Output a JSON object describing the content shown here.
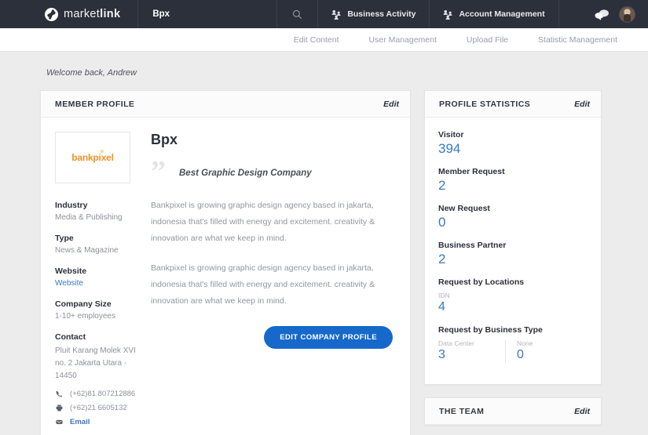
{
  "header": {
    "logo_text_light": "market",
    "logo_text_bold": "link",
    "logo_icon": "marketlink-circle-icon",
    "org": "Bpx",
    "search_icon": "search-icon",
    "items": [
      {
        "label": "Business Activity",
        "icon": "people-group-icon"
      },
      {
        "label": "Account Management",
        "icon": "people-group-icon"
      }
    ],
    "chat_icon": "chat-bubbles-icon",
    "avatar": "user-avatar"
  },
  "subnav": {
    "items": [
      "Edit Content",
      "User Management",
      "Upload File",
      "Statistic Management"
    ]
  },
  "welcome": "Welcome back, Andrew",
  "member_profile": {
    "title": "MEMBER PROFILE",
    "edit_label": "Edit",
    "logo_word": "bankpixel",
    "org_name": "Bpx",
    "tagline": "Best Graphic Design Company",
    "paragraph_1": "Bankpixel is growing graphic design agency based in jakarta, indonesia that's filled with energy and excitement. creativity & innovation are what we keep in mind.",
    "paragraph_2": "Bankpixel is growing graphic design agency based in jakarta, indonesia that's filled with energy and excitement. creativity & innovation are what we keep in mind.",
    "cta_label": "EDIT COMPANY PROFILE",
    "fields": [
      {
        "label": "Industry",
        "value": "Media & Publishing"
      },
      {
        "label": "Type",
        "value": "News & Magazine"
      },
      {
        "label": "Website",
        "value": "Website",
        "is_link": true
      },
      {
        "label": "Company Size",
        "value": "1-10+ employees"
      }
    ],
    "contact": {
      "label": "Contact",
      "address": "Pluit Karang Molek XVI no. 2 Jakarta Utara - 14450",
      "phone": "(+62)81 807212886",
      "fax": "(+62)21 6605132",
      "email": "Email"
    }
  },
  "profile_statistics": {
    "title": "PROFILE STATISTICS",
    "edit_label": "Edit",
    "stats": [
      {
        "label": "Visitor",
        "value": "394"
      },
      {
        "label": "Member Request",
        "value": "2"
      },
      {
        "label": "New Request",
        "value": "0"
      },
      {
        "label": "Business Partner",
        "value": "2"
      }
    ],
    "by_locations": {
      "label": "Request by Locations",
      "items": [
        {
          "label": "IDN",
          "value": "4"
        }
      ]
    },
    "by_business_type": {
      "label": "Request by Business Type",
      "items": [
        {
          "label": "Data Center",
          "value": "3"
        },
        {
          "label": "None",
          "value": "0"
        }
      ]
    }
  },
  "the_team": {
    "title": "THE TEAM",
    "edit_label": "Edit"
  },
  "colors": {
    "header_bg": "#2b303b",
    "accent_blue": "#3b78c3",
    "button_blue": "#1668cb",
    "logo_orange": "#f2922b",
    "page_bg": "#ececec"
  }
}
